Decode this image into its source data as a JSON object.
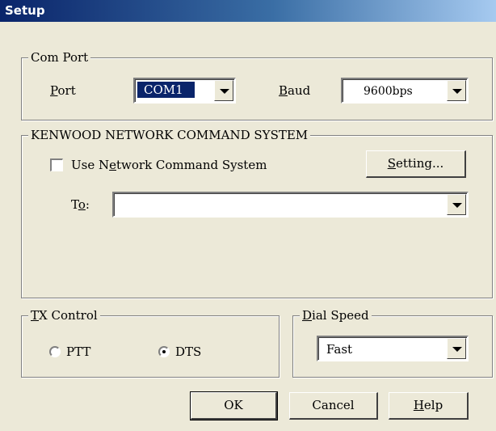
{
  "window": {
    "title": "Setup"
  },
  "com_port": {
    "legend": "Com Port",
    "port_label_ul": "P",
    "port_label_rest": "ort",
    "port_value": "COM1",
    "baud_label_ul": "B",
    "baud_label_rest": "aud",
    "baud_value": "9600bps"
  },
  "network": {
    "legend": "KENWOOD NETWORK COMMAND SYSTEM",
    "use_label_pre": "Use N",
    "use_label_ul": "e",
    "use_label_post": "twork Command System",
    "use_checked": false,
    "setting_ul": "S",
    "setting_rest": "etting...",
    "to_label_pre": "T",
    "to_label_ul": "o",
    "to_label_post": ":",
    "to_value": ""
  },
  "tx_control": {
    "legend_ul": "T",
    "legend_rest": "X Control",
    "ptt_label": "PTT",
    "ptt_selected": false,
    "dts_label": "DTS",
    "dts_selected": true
  },
  "dial_speed": {
    "legend_ul": "D",
    "legend_rest": "ial Speed",
    "value": "Fast"
  },
  "buttons": {
    "ok": "OK",
    "cancel": "Cancel",
    "help_ul": "H",
    "help_rest": "elp"
  }
}
